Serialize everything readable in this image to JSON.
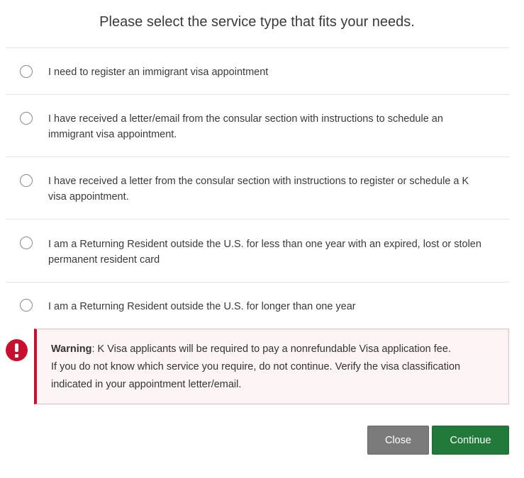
{
  "dialog": {
    "title": "Please select the service type that fits your needs.",
    "options": [
      {
        "label": "I need to register an immigrant visa appointment"
      },
      {
        "label": "I have received a letter/email from the consular section with instructions to schedule an immigrant visa appointment."
      },
      {
        "label": "I have received a letter from the consular section with instructions to register or schedule a K visa appointment."
      },
      {
        "label": "I am a Returning Resident outside the U.S. for less than one year with an expired, lost or stolen permanent resident card"
      },
      {
        "label": "I am a Returning Resident outside the U.S. for longer than one year"
      }
    ],
    "warning": {
      "heading": "Warning",
      "line1": ": K Visa applicants will be required to pay a nonrefundable Visa application fee.",
      "line2": "If you do not know which service you require, do not continue. Verify the visa classification indicated in your appointment letter/email."
    },
    "buttons": {
      "close_label": "Close",
      "continue_label": "Continue"
    },
    "colors": {
      "warning_accent": "#c8102e",
      "continue_button": "#227a3a",
      "close_button": "#7b7b7b"
    },
    "icons": {
      "warning": "exclamation-circle-icon"
    }
  }
}
